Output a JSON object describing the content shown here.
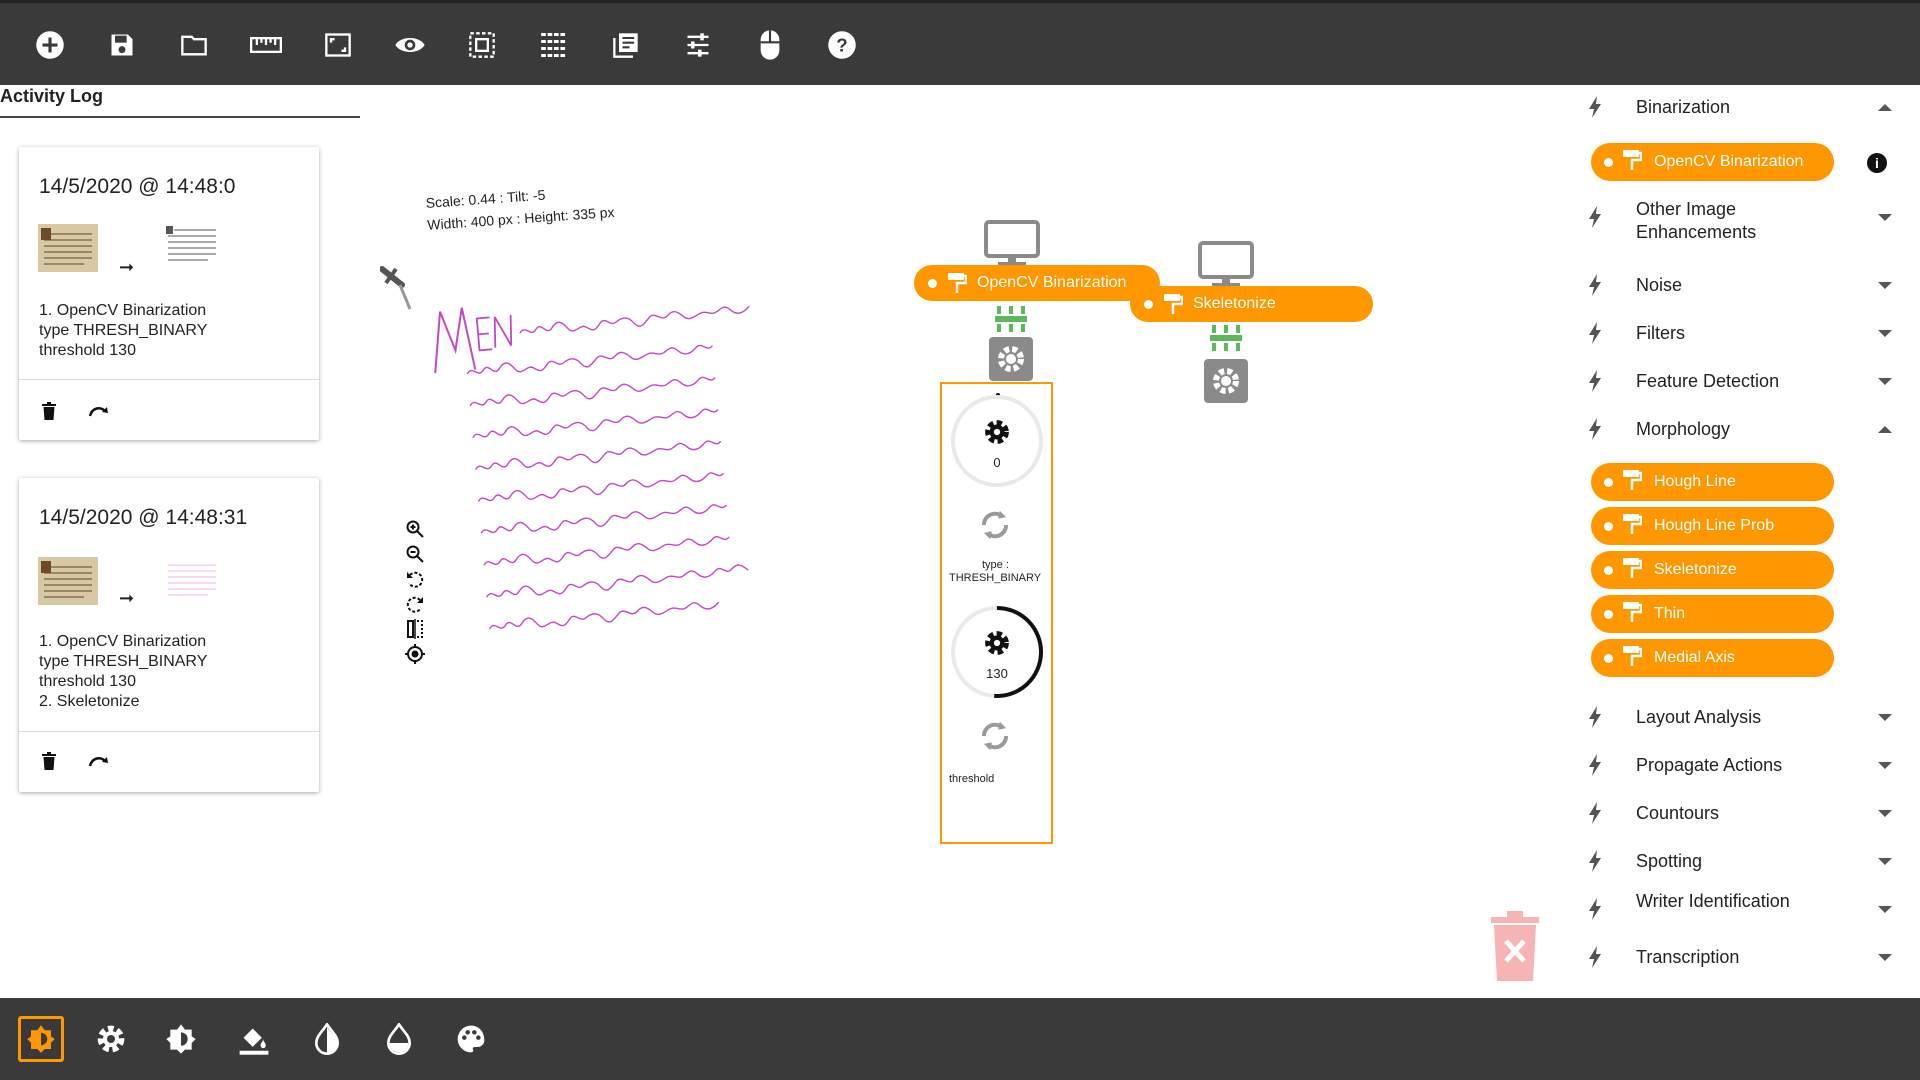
{
  "toolbar": {
    "top_icons": [
      "add-icon",
      "save-icon",
      "folder-icon",
      "ruler-icon",
      "aspect-ratio-icon",
      "eye-icon",
      "select-all-icon",
      "table-rows-icon",
      "library-books-icon",
      "tune-icon",
      "mouse-icon",
      "help-icon"
    ],
    "bottom_icons": [
      "brightness-icon",
      "settings-icon",
      "brightness-medium-icon",
      "format-color-fill-icon",
      "invert-colors-icon",
      "opacity-icon",
      "palette-icon"
    ]
  },
  "activity_log": {
    "title": "Activity Log",
    "entries": [
      {
        "date": "14/5/2020 @ 14:48:0",
        "lines": [
          "1. OpenCV Binarization",
          "type THRESH_BINARY",
          "threshold 130"
        ]
      },
      {
        "date": "14/5/2020 @ 14:48:31",
        "lines": [
          "1. OpenCV Binarization",
          "type THRESH_BINARY",
          "threshold 130",
          "2. Skeletonize"
        ]
      }
    ]
  },
  "canvas": {
    "scale_text": "Scale: 0.44 : Tilt: -5",
    "size_text": "Width: 400 px : Height: 335 px"
  },
  "pipeline": {
    "nodes": [
      {
        "label": "OpenCV Binarization"
      },
      {
        "label": "Skeletonize"
      }
    ],
    "params": {
      "knob1_value": "0",
      "type_label": "type :",
      "type_value": "THRESH_BINARY",
      "knob2_value": "130",
      "knob2_fraction": 0.51,
      "threshold_label": "threshold"
    }
  },
  "right_panel": {
    "sections": [
      {
        "label": "Binarization",
        "expanded": true,
        "items": [
          "OpenCV Binarization"
        ]
      },
      {
        "label": "Other Image Enhancements",
        "expanded": false
      },
      {
        "label": "Noise",
        "expanded": false
      },
      {
        "label": "Filters",
        "expanded": false
      },
      {
        "label": "Feature Detection",
        "expanded": false
      },
      {
        "label": "Morphology",
        "expanded": true,
        "items": [
          "Hough Line",
          "Hough Line Prob",
          "Skeletonize",
          "Thin",
          "Medial Axis"
        ]
      },
      {
        "label": "Layout Analysis",
        "expanded": false
      },
      {
        "label": "Propagate Actions",
        "expanded": false
      },
      {
        "label": "Countours",
        "expanded": false
      },
      {
        "label": "Spotting",
        "expanded": false
      },
      {
        "label": "Writer Identification",
        "expanded": false
      },
      {
        "label": "Transcription",
        "expanded": false
      }
    ]
  },
  "colors": {
    "accent": "#ff9800",
    "bar": "#3a3a3a",
    "ink": "#c23fc2",
    "connector": "#5cb85c"
  }
}
